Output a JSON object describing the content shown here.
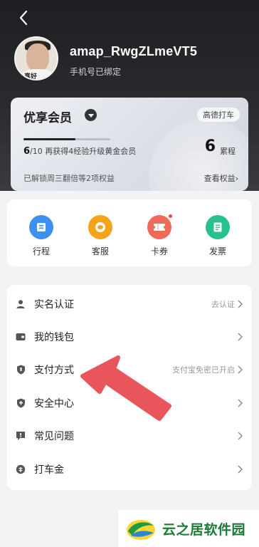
{
  "profile": {
    "username": "amap_RwgZLmeVT5",
    "phone_status": "手机号已绑定",
    "avatar_tag": "真好"
  },
  "vip": {
    "title": "优享会员",
    "badge": "高德打车",
    "progress_current": "6",
    "progress_total": "/10",
    "progress_desc": "再获得4经验升级黄金会员",
    "progress_fraction": 0.6,
    "trips_count": "6",
    "trips_unit": "累程",
    "unlock_text": "已解锁周三翻倍等2项权益",
    "view_benefits": "查看权益›"
  },
  "quick_actions": [
    {
      "label": "行程",
      "icon": "trip-icon",
      "color": "#3d8ff0"
    },
    {
      "label": "客服",
      "icon": "customer-service-icon",
      "color": "#f7a21b"
    },
    {
      "label": "卡券",
      "icon": "coupon-icon",
      "color": "#f06a5a"
    },
    {
      "label": "发票",
      "icon": "invoice-icon",
      "color": "#27c08f"
    }
  ],
  "menu": [
    {
      "label": "实名认证",
      "hint": "去认证",
      "icon": "user-icon"
    },
    {
      "label": "我的钱包",
      "hint": "",
      "icon": "wallet-icon"
    },
    {
      "label": "支付方式",
      "hint": "支付宝免密已开启",
      "icon": "shield-icon"
    },
    {
      "label": "安全中心",
      "hint": "",
      "icon": "security-icon"
    },
    {
      "label": "常见问题",
      "hint": "",
      "icon": "faq-icon"
    },
    {
      "label": "打车金",
      "hint": "",
      "icon": "coin-icon"
    }
  ],
  "watermark": {
    "text": "云之居软件园"
  },
  "colors": {
    "header_bg": "#1f1f23",
    "arrow": "#e8565b",
    "watermark_green": "#1b7a36"
  }
}
